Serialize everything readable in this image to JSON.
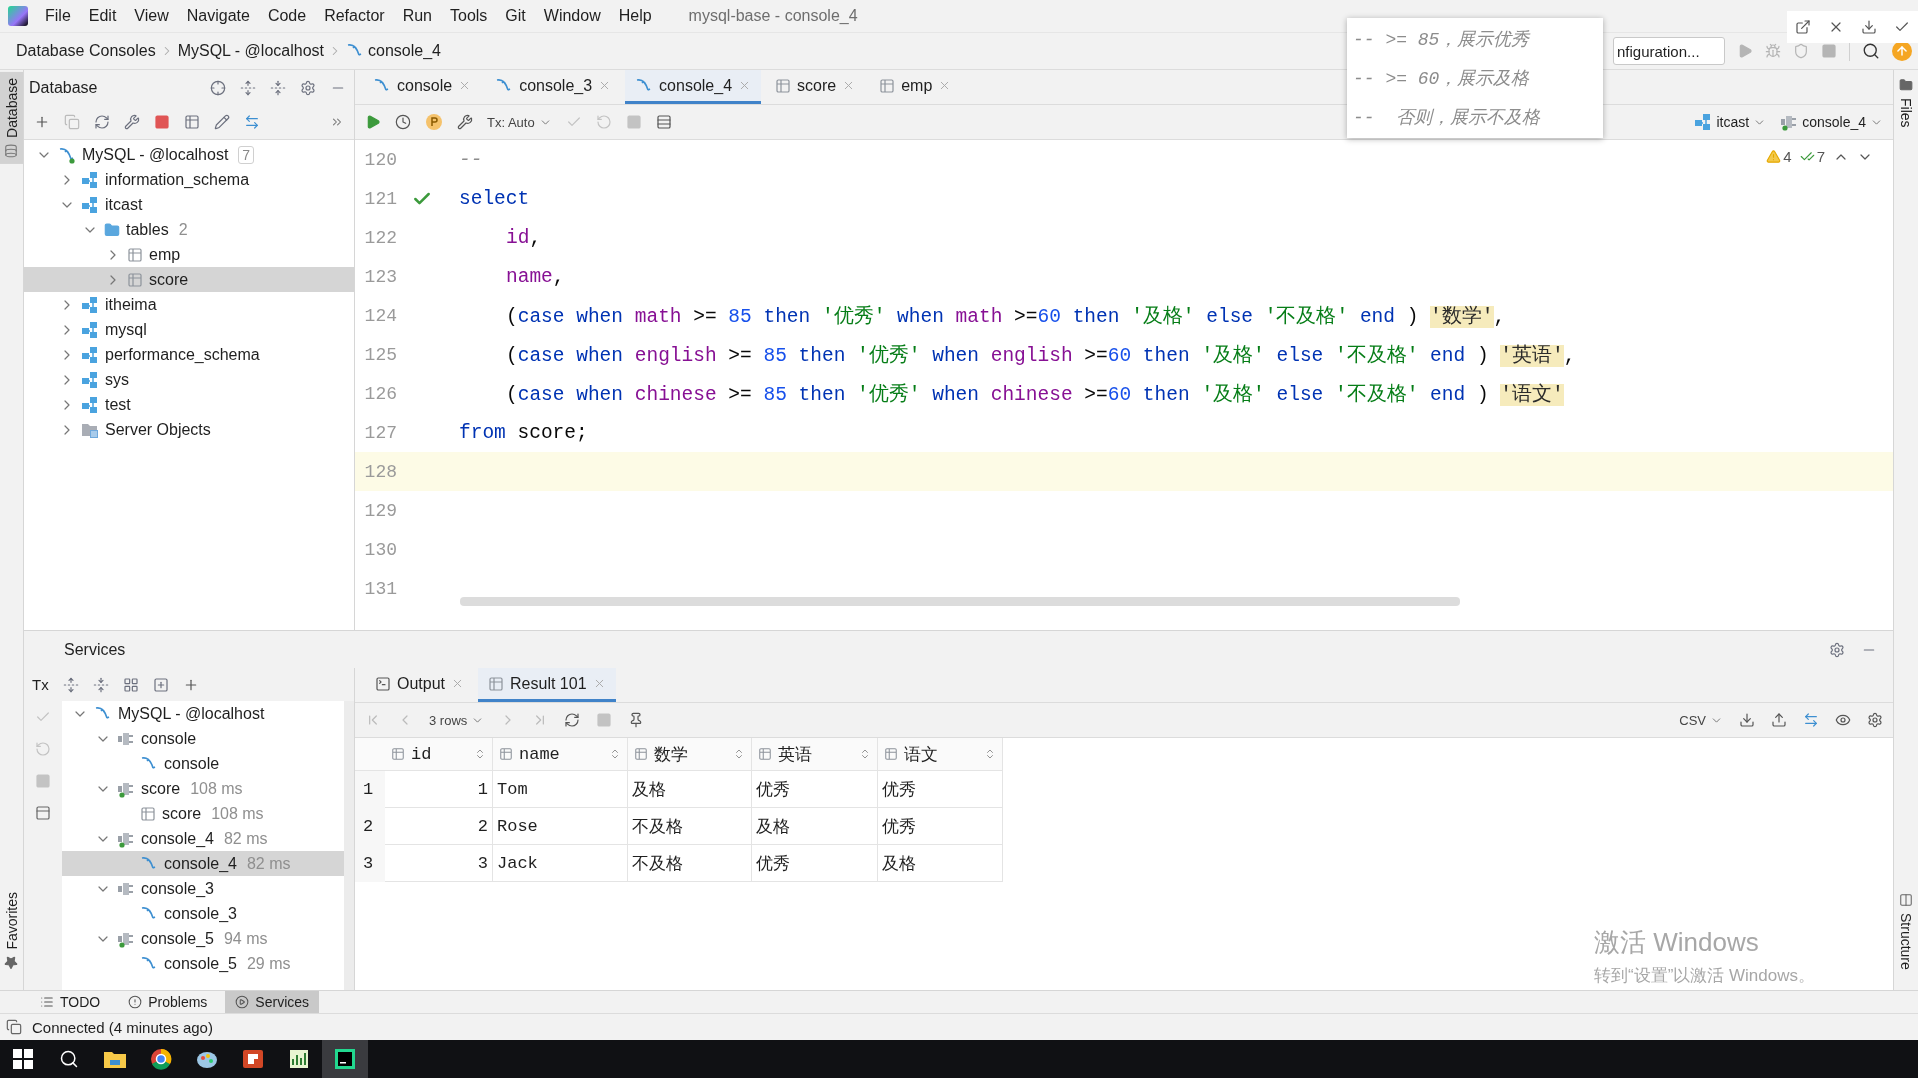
{
  "menu_bar": {
    "items": [
      "File",
      "Edit",
      "View",
      "Navigate",
      "Code",
      "Refactor",
      "Run",
      "Tools",
      "Git",
      "Window",
      "Help"
    ],
    "title": "mysql-base - console_4"
  },
  "navigation_bar": {
    "breadcrumbs": [
      {
        "label": "Database Consoles",
        "kind": "plain"
      },
      {
        "label": "MySQL - @localhost",
        "kind": "plain"
      },
      {
        "label": "console_4",
        "kind": "console"
      }
    ],
    "run_configuration": "nfiguration..."
  },
  "left_stripe": {
    "top": {
      "label": "Database",
      "selected": true
    },
    "bottom": {
      "label": "Favorites",
      "selected": false
    }
  },
  "right_stripe": {
    "top": {
      "label": "Files",
      "selected": false
    },
    "bottom": {
      "label": "Structure",
      "selected": false
    }
  },
  "database_panel": {
    "title": "Database",
    "tree": [
      {
        "label": "MySQL - @localhost",
        "kind": "connection",
        "active": true,
        "count": "7",
        "expanded": true,
        "selected": false,
        "children": [
          {
            "label": "information_schema",
            "kind": "schema",
            "expanded": false,
            "selected": false
          },
          {
            "label": "itcast",
            "kind": "schema",
            "expanded": true,
            "selected": false,
            "children": [
              {
                "label": "tables",
                "kind": "folder",
                "count": "2",
                "expanded": true,
                "selected": false,
                "children": [
                  {
                    "label": "emp",
                    "kind": "table",
                    "expanded": false,
                    "selected": false
                  },
                  {
                    "label": "score",
                    "kind": "table",
                    "expanded": false,
                    "selected": true
                  }
                ]
              }
            ]
          },
          {
            "label": "itheima",
            "kind": "schema",
            "expanded": false,
            "selected": false
          },
          {
            "label": "mysql",
            "kind": "schema",
            "expanded": false,
            "selected": false
          },
          {
            "label": "performance_schema",
            "kind": "schema",
            "expanded": false,
            "selected": false
          },
          {
            "label": "sys",
            "kind": "schema",
            "expanded": false,
            "selected": false
          },
          {
            "label": "test",
            "kind": "schema",
            "expanded": false,
            "selected": false
          },
          {
            "label": "Server Objects",
            "kind": "server",
            "expanded": false,
            "selected": false
          }
        ]
      }
    ]
  },
  "editor": {
    "tabs": [
      {
        "label": "console",
        "kind": "console",
        "selected": false
      },
      {
        "label": "console_3",
        "kind": "console",
        "selected": false
      },
      {
        "label": "console_4",
        "kind": "console",
        "selected": true
      },
      {
        "label": "score",
        "kind": "table",
        "selected": false
      },
      {
        "label": "emp",
        "kind": "table",
        "selected": false
      }
    ],
    "transaction_mode": "Tx: Auto",
    "schema": "itcast",
    "session": "console_4",
    "warnings": "4",
    "checks": "7",
    "lines": [
      {
        "number": "120",
        "check": false,
        "current": false,
        "indented": false,
        "tokens": [
          {
            "kind": "comment",
            "text": "--"
          }
        ]
      },
      {
        "number": "121",
        "check": true,
        "current": false,
        "indented": false,
        "tokens": [
          {
            "kind": "keyword",
            "text": "select"
          }
        ]
      },
      {
        "number": "122",
        "check": false,
        "current": false,
        "indented": true,
        "tokens": [
          {
            "kind": "column",
            "text": "id"
          },
          {
            "kind": "plain",
            "text": ","
          }
        ]
      },
      {
        "number": "123",
        "check": false,
        "current": false,
        "indented": true,
        "tokens": [
          {
            "kind": "column",
            "text": "name"
          },
          {
            "kind": "plain",
            "text": ","
          }
        ]
      },
      {
        "number": "124",
        "check": false,
        "current": false,
        "indented": true,
        "tokens": [
          {
            "kind": "plain",
            "text": "("
          },
          {
            "kind": "keyword",
            "text": "case when "
          },
          {
            "kind": "column",
            "text": "math"
          },
          {
            "kind": "plain",
            "text": " >= "
          },
          {
            "kind": "number",
            "text": "85"
          },
          {
            "kind": "keyword",
            "text": " then "
          },
          {
            "kind": "string",
            "text": "'优秀'"
          },
          {
            "kind": "keyword",
            "text": " when "
          },
          {
            "kind": "column",
            "text": "math"
          },
          {
            "kind": "plain",
            "text": " >="
          },
          {
            "kind": "number",
            "text": "60"
          },
          {
            "kind": "keyword",
            "text": " then "
          },
          {
            "kind": "string",
            "text": "'及格'"
          },
          {
            "kind": "keyword",
            "text": " else "
          },
          {
            "kind": "string",
            "text": "'不及格'"
          },
          {
            "kind": "keyword",
            "text": " end"
          },
          {
            "kind": "plain",
            "text": " ) "
          },
          {
            "kind": "alias",
            "text": "'数学'"
          },
          {
            "kind": "plain",
            "text": ","
          }
        ]
      },
      {
        "number": "125",
        "check": false,
        "current": false,
        "indented": true,
        "tokens": [
          {
            "kind": "plain",
            "text": "("
          },
          {
            "kind": "keyword",
            "text": "case when "
          },
          {
            "kind": "column",
            "text": "english"
          },
          {
            "kind": "plain",
            "text": " >= "
          },
          {
            "kind": "number",
            "text": "85"
          },
          {
            "kind": "keyword",
            "text": " then "
          },
          {
            "kind": "string",
            "text": "'优秀'"
          },
          {
            "kind": "keyword",
            "text": " when "
          },
          {
            "kind": "column",
            "text": "english"
          },
          {
            "kind": "plain",
            "text": " >="
          },
          {
            "kind": "number",
            "text": "60"
          },
          {
            "kind": "keyword",
            "text": " then "
          },
          {
            "kind": "string",
            "text": "'及格'"
          },
          {
            "kind": "keyword",
            "text": " else "
          },
          {
            "kind": "string",
            "text": "'不及格'"
          },
          {
            "kind": "keyword",
            "text": " end"
          },
          {
            "kind": "plain",
            "text": " ) "
          },
          {
            "kind": "alias",
            "text": "'英语'"
          },
          {
            "kind": "plain",
            "text": ","
          }
        ]
      },
      {
        "number": "126",
        "check": false,
        "current": false,
        "indented": true,
        "tokens": [
          {
            "kind": "plain",
            "text": "("
          },
          {
            "kind": "keyword",
            "text": "case when "
          },
          {
            "kind": "column",
            "text": "chinese"
          },
          {
            "kind": "plain",
            "text": " >= "
          },
          {
            "kind": "number",
            "text": "85"
          },
          {
            "kind": "keyword",
            "text": " then "
          },
          {
            "kind": "string",
            "text": "'优秀'"
          },
          {
            "kind": "keyword",
            "text": " when "
          },
          {
            "kind": "column",
            "text": "chinese"
          },
          {
            "kind": "plain",
            "text": " >="
          },
          {
            "kind": "number",
            "text": "60"
          },
          {
            "kind": "keyword",
            "text": " then "
          },
          {
            "kind": "string",
            "text": "'及格'"
          },
          {
            "kind": "keyword",
            "text": " else "
          },
          {
            "kind": "string",
            "text": "'不及格'"
          },
          {
            "kind": "keyword",
            "text": " end"
          },
          {
            "kind": "plain",
            "text": " ) "
          },
          {
            "kind": "alias",
            "text": "'语文'"
          }
        ]
      },
      {
        "number": "127",
        "check": false,
        "current": false,
        "indented": false,
        "tokens": [
          {
            "kind": "keyword",
            "text": "from"
          },
          {
            "kind": "plain",
            "text": " score;"
          }
        ]
      },
      {
        "number": "128",
        "check": false,
        "current": true,
        "indented": false
      },
      {
        "number": "129",
        "check": false,
        "current": false,
        "indented": false
      },
      {
        "number": "130",
        "check": false,
        "current": false,
        "indented": false
      },
      {
        "number": "131",
        "check": false,
        "current": false,
        "indented": false
      }
    ]
  },
  "popup": {
    "lines": [
      "-- >= 85，展示优秀",
      "-- >= 60，展示及格",
      "--  否则，展示不及格"
    ]
  },
  "services": {
    "title": "Services",
    "tx_label": "Tx",
    "tree": [
      {
        "label": "MySQL - @localhost",
        "kind": "connection",
        "active": false,
        "expanded": true,
        "selected": false,
        "children": [
          {
            "label": "console",
            "kind": "session",
            "active": false,
            "expanded": true,
            "selected": false,
            "children": [
              {
                "label": "console",
                "kind": "console",
                "selected": false
              }
            ]
          },
          {
            "label": "score",
            "time": "108 ms",
            "kind": "session",
            "active": true,
            "expanded": true,
            "selected": false,
            "children": [
              {
                "label": "score",
                "time": "108 ms",
                "kind": "table",
                "selected": false
              }
            ]
          },
          {
            "label": "console_4",
            "time": "82 ms",
            "kind": "session",
            "active": true,
            "expanded": true,
            "selected": false,
            "children": [
              {
                "label": "console_4",
                "time": "82 ms",
                "kind": "console",
                "selected": true
              }
            ]
          },
          {
            "label": "console_3",
            "kind": "session",
            "active": false,
            "expanded": true,
            "selected": false,
            "children": [
              {
                "label": "console_3",
                "kind": "console",
                "selected": false
              }
            ]
          },
          {
            "label": "console_5",
            "time": "94 ms",
            "kind": "session",
            "active": true,
            "expanded": true,
            "selected": false,
            "children": [
              {
                "label": "console_5",
                "time": "29 ms",
                "kind": "console",
                "selected": false
              }
            ]
          }
        ]
      }
    ],
    "tabs": [
      {
        "label": "Output",
        "kind": "output",
        "selected": false
      },
      {
        "label": "Result 101",
        "kind": "result",
        "selected": true
      }
    ],
    "rows_label": "3 rows",
    "export_format": "CSV",
    "result": {
      "columns": [
        {
          "label": "id",
          "kind": "number"
        },
        {
          "label": "name",
          "kind": "text"
        },
        {
          "label": "数学",
          "kind": "text"
        },
        {
          "label": "英语",
          "kind": "text"
        },
        {
          "label": "语文",
          "kind": "text"
        }
      ],
      "rows": [
        {
          "number": "1",
          "cells": [
            "1",
            "Tom",
            "及格",
            "优秀",
            "优秀"
          ]
        },
        {
          "number": "2",
          "cells": [
            "2",
            "Rose",
            "不及格",
            "及格",
            "优秀"
          ]
        },
        {
          "number": "3",
          "cells": [
            "3",
            "Jack",
            "不及格",
            "优秀",
            "及格"
          ]
        }
      ]
    }
  },
  "bottom_tabs": [
    {
      "label": "TODO",
      "kind": "todo",
      "selected": false
    },
    {
      "label": "Problems",
      "kind": "problems",
      "selected": false
    },
    {
      "label": "Services",
      "kind": "services",
      "selected": true
    }
  ],
  "status_bar": {
    "message": "Connected (4 minutes ago)"
  },
  "windows_activation": {
    "title": "激活 Windows",
    "hint": "转到“设置”以激活 Windows。"
  }
}
